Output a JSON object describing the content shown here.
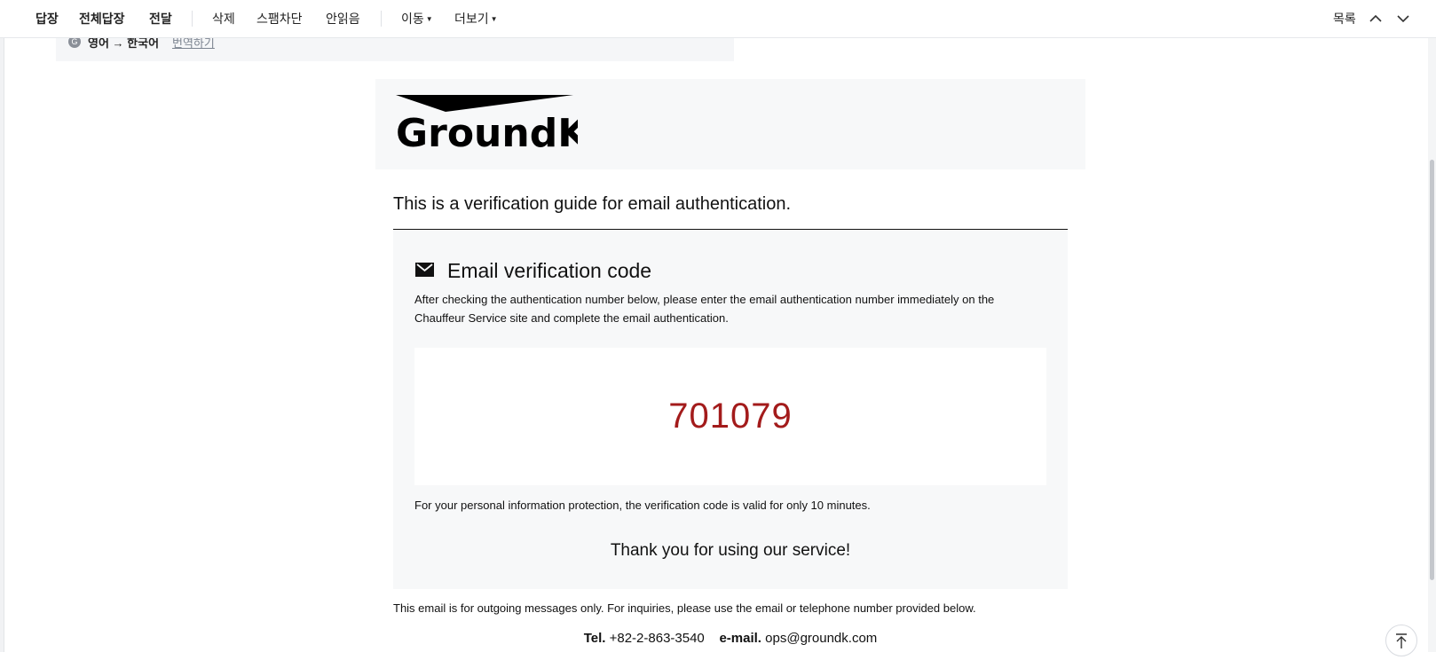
{
  "toolbar": {
    "reply": "답장",
    "reply_all": "전체답장",
    "forward": "전달",
    "delete": "삭제",
    "block_spam": "스팸차단",
    "unread": "안읽음",
    "move": "이동",
    "more": "더보기",
    "list": "목록"
  },
  "translate": {
    "languages": "영어 → 한국어",
    "action": "번역하기"
  },
  "email": {
    "brand": "GroundK",
    "guide_title": "This is a verification guide for email authentication.",
    "card_title": "Email verification code",
    "description": "After checking the authentication number below, please enter the email authentication number immediately on the Chauffeur Service site and complete the email authentication.",
    "code": "701079",
    "valid_note": "For your personal information protection, the verification code is valid for only 10 minutes.",
    "thanks": "Thank you for using our service!",
    "footer_note": "This email is for outgoing messages only. For inquiries, please use the email or telephone number provided below.",
    "tel_label": "Tel.",
    "tel": "+82-2-863-3540",
    "email_label": "e-mail.",
    "email": "ops@groundk.com"
  },
  "colors": {
    "code": "#a31b1b",
    "card_bg": "#f7f8f9"
  }
}
